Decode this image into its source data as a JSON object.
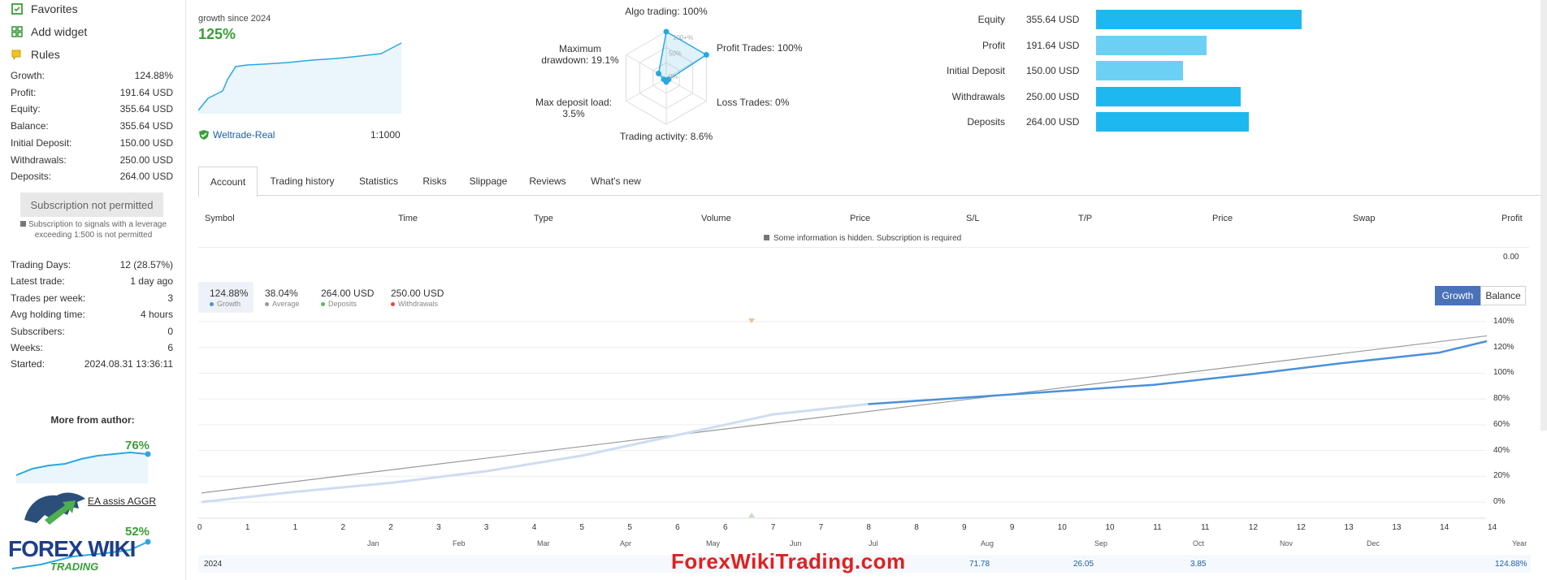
{
  "sidebar": {
    "menu": [
      {
        "label": "Favorites",
        "icon": "favorites-icon"
      },
      {
        "label": "Add widget",
        "icon": "widget-icon"
      },
      {
        "label": "Rules",
        "icon": "rules-icon"
      }
    ],
    "stats": [
      {
        "label": "Growth:",
        "value": "124.88%"
      },
      {
        "label": "Profit:",
        "value": "191.64 USD"
      },
      {
        "label": "Equity:",
        "value": "355.64 USD"
      },
      {
        "label": "Balance:",
        "value": "355.64 USD"
      },
      {
        "label": "Initial Deposit:",
        "value": "150.00 USD"
      },
      {
        "label": "Withdrawals:",
        "value": "250.00 USD"
      },
      {
        "label": "Deposits:",
        "value": "264.00 USD"
      }
    ],
    "subscription_button": "Subscription not permitted",
    "subscription_note": "Subscription to signals with a leverage exceeding 1:500 is not permitted",
    "stats2": [
      {
        "label": "Trading Days:",
        "value": "12 (28.57%)"
      },
      {
        "label": "Latest trade:",
        "value": "1 day ago"
      },
      {
        "label": "Trades per week:",
        "value": "3"
      },
      {
        "label": "Avg holding time:",
        "value": "4 hours"
      },
      {
        "label": "Subscribers:",
        "value": "0"
      },
      {
        "label": "Weeks:",
        "value": "6"
      },
      {
        "label": "Started:",
        "value": "2024.08.31 13:36:11"
      }
    ],
    "more_from_author": "More from author:",
    "author_items": [
      {
        "growth": "76%"
      },
      {
        "name": "EA assis AGGR",
        "growth": "52%"
      }
    ],
    "logo_text_1": "FOREX WIKI",
    "logo_text_2": "TRADING"
  },
  "summary": {
    "growth_label": "growth since 2024",
    "growth_value": "125%",
    "broker": "Weltrade-Real",
    "leverage": "1:1000"
  },
  "radar": {
    "labels": {
      "algo": "Algo trading: 100%",
      "profit_trades": "Profit Trades: 100%",
      "loss_trades": "Loss Trades: 0%",
      "activity": "Trading activity: 8.6%",
      "load": "Max deposit load: 3.5%",
      "drawdown": "Maximum drawdown: 19.1%"
    },
    "ring_labels": [
      "100+%",
      "50%",
      "0%"
    ],
    "values": [
      100,
      100,
      0,
      8.6,
      3.5,
      19.1
    ]
  },
  "bars": [
    {
      "label": "Equity",
      "value": "355.64 USD",
      "amount": 355.64,
      "color": "#1eb8f0"
    },
    {
      "label": "Profit",
      "value": "191.64 USD",
      "amount": 191.64,
      "color": "#6cd0f5"
    },
    {
      "label": "Initial Deposit",
      "value": "150.00 USD",
      "amount": 150.0,
      "color": "#6cd0f5"
    },
    {
      "label": "Withdrawals",
      "value": "250.00 USD",
      "amount": 250.0,
      "color": "#1eb8f0"
    },
    {
      "label": "Deposits",
      "value": "264.00 USD",
      "amount": 264.0,
      "color": "#1eb8f0"
    }
  ],
  "tabs": [
    "Account",
    "Trading history",
    "Statistics",
    "Risks",
    "Slippage",
    "Reviews",
    "What's new"
  ],
  "table": {
    "headers": [
      "Symbol",
      "Time",
      "Type",
      "Volume",
      "Price",
      "S/L",
      "T/P",
      "Price",
      "Swap",
      "Profit"
    ],
    "hidden_note": "Some information is hidden. Subscription is required",
    "total": "0.00"
  },
  "legend": [
    {
      "value": "124.88%",
      "label": "Growth",
      "color": "#4a90d9"
    },
    {
      "value": "38.04%",
      "label": "Average",
      "color": "#999999"
    },
    {
      "value": "264.00 USD",
      "label": "Deposits",
      "color": "#5cb85c"
    },
    {
      "value": "250.00 USD",
      "label": "Withdrawals",
      "color": "#e74c3c"
    }
  ],
  "toggle": {
    "growth": "Growth",
    "balance": "Balance"
  },
  "chart_data": {
    "type": "line",
    "y_ticks": [
      "140%",
      "120%",
      "100%",
      "80%",
      "60%",
      "40%",
      "20%",
      "0%"
    ],
    "x_ticks": [
      "0",
      "1",
      "1",
      "2",
      "2",
      "3",
      "3",
      "4",
      "5",
      "5",
      "6",
      "6",
      "7",
      "7",
      "8",
      "8",
      "9",
      "9",
      "10",
      "10",
      "11",
      "11",
      "12",
      "12",
      "13",
      "13",
      "14",
      "14"
    ],
    "months": [
      "Jan",
      "Feb",
      "Mar",
      "Apr",
      "May",
      "Jun",
      "Jul",
      "Aug",
      "Sep",
      "Oct",
      "Nov",
      "Dec",
      "Year"
    ],
    "ylim": [
      0,
      140
    ],
    "series": [
      {
        "name": "Growth",
        "x": [
          0,
          2,
          4,
          6,
          8,
          10,
          12,
          14,
          16,
          18,
          20,
          22,
          24,
          26,
          27
        ],
        "y": [
          0,
          8,
          15,
          24,
          36,
          52,
          68,
          76,
          81,
          86,
          91,
          99,
          108,
          116,
          124.88
        ]
      },
      {
        "name": "Average",
        "x": [
          0,
          27
        ],
        "y": [
          7,
          129
        ]
      }
    ]
  },
  "year_row": {
    "year": "2024",
    "aug": "71.78",
    "sep": "26.05",
    "oct": "3.85",
    "total": "124.88%"
  },
  "watermark": "ForexWikiTrading.com"
}
